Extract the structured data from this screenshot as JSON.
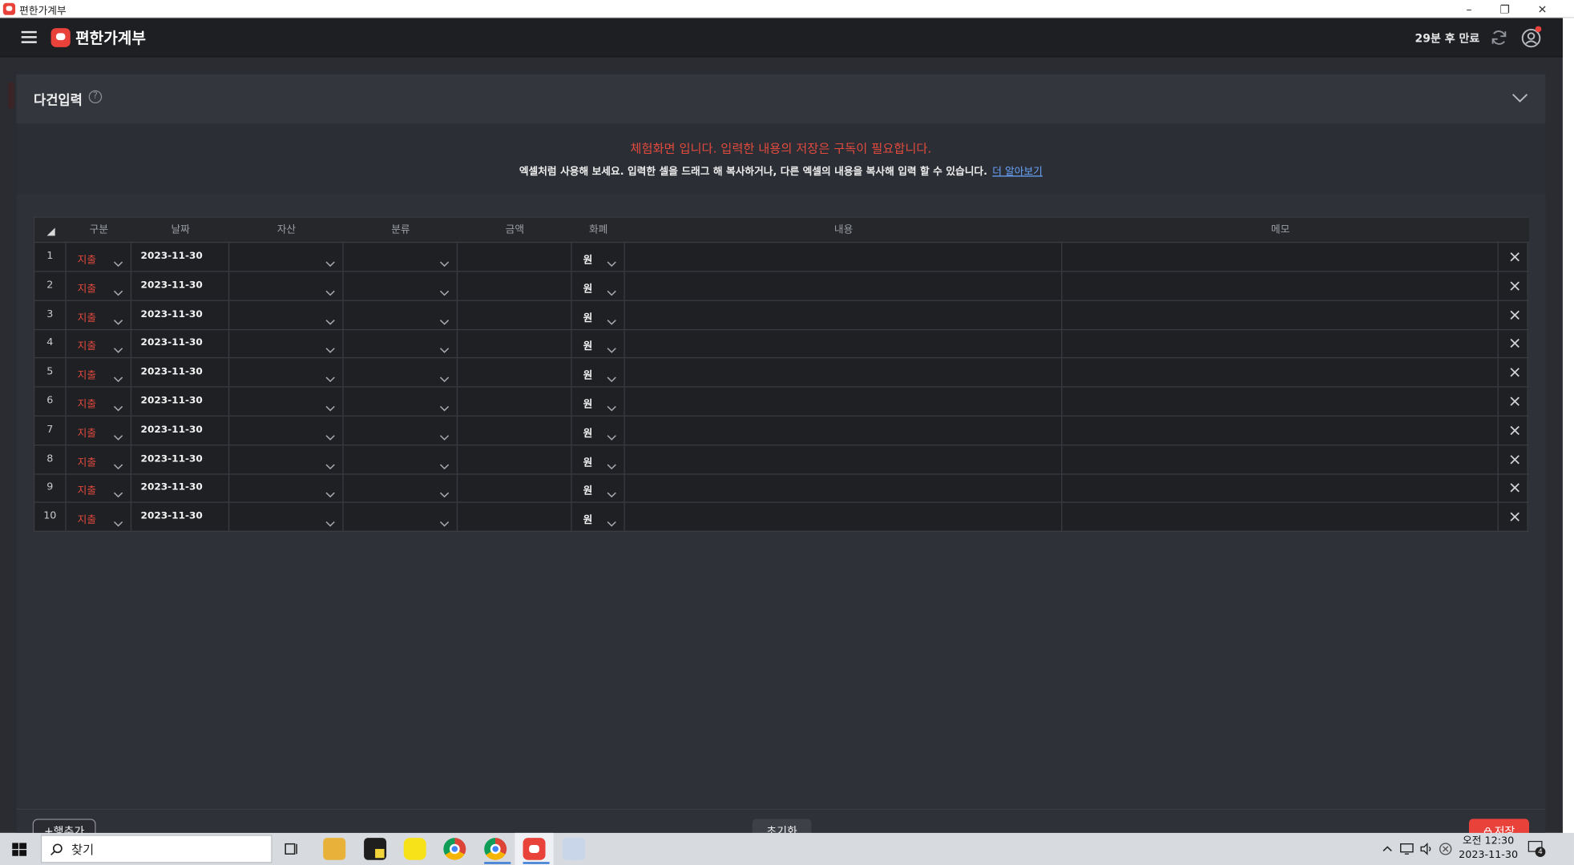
{
  "window": {
    "title": "편한가계부",
    "minimize": "–",
    "restore": "❐",
    "close": "✕"
  },
  "header": {
    "app_name": "편한가계부",
    "expire": "29분 후 만료"
  },
  "panel": {
    "title": "다건입력",
    "help": "?",
    "notice_red": "체험화면 입니다. 입력한 내용의 저장은 구독이 필요합니다.",
    "notice_white": "엑셀처럼 사용해 보세요. 입력한 셀을 드래그 해 복사하거나, 다른 엑셀의 내용을 복사해 입력 할 수 있습니다.",
    "learn_more": "더 알아보기"
  },
  "table": {
    "columns": [
      "구분",
      "날짜",
      "자산",
      "분류",
      "금액",
      "화폐",
      "내용",
      "메모"
    ],
    "rows": [
      {
        "num": "1",
        "type": "지출",
        "date": "2023-11-30",
        "currency": "원"
      },
      {
        "num": "2",
        "type": "지출",
        "date": "2023-11-30",
        "currency": "원"
      },
      {
        "num": "3",
        "type": "지출",
        "date": "2023-11-30",
        "currency": "원"
      },
      {
        "num": "4",
        "type": "지출",
        "date": "2023-11-30",
        "currency": "원"
      },
      {
        "num": "5",
        "type": "지출",
        "date": "2023-11-30",
        "currency": "원"
      },
      {
        "num": "6",
        "type": "지출",
        "date": "2023-11-30",
        "currency": "원"
      },
      {
        "num": "7",
        "type": "지출",
        "date": "2023-11-30",
        "currency": "원"
      },
      {
        "num": "8",
        "type": "지출",
        "date": "2023-11-30",
        "currency": "원"
      },
      {
        "num": "9",
        "type": "지출",
        "date": "2023-11-30",
        "currency": "원"
      },
      {
        "num": "10",
        "type": "지출",
        "date": "2023-11-30",
        "currency": "원"
      }
    ]
  },
  "footer": {
    "add_row": "+행추가",
    "reset": "초기화",
    "save": "저장"
  },
  "taskbar": {
    "search": "찾기",
    "time": "오전 12:30",
    "date": "2023-11-30",
    "notifications": "4"
  },
  "colors": {
    "accent": "#e8423b",
    "background": "#2a2c31",
    "header": "#1e1f23"
  }
}
